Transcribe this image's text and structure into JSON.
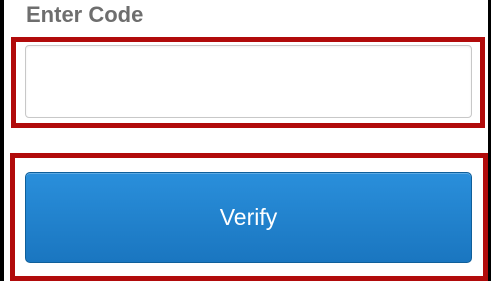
{
  "form": {
    "code_label": "Enter Code",
    "code_value": "",
    "verify_label": "Verify"
  },
  "colors": {
    "highlight": "#b10b0b",
    "button_blue": "#1a7fd0",
    "label_gray": "#6e6e6e"
  }
}
